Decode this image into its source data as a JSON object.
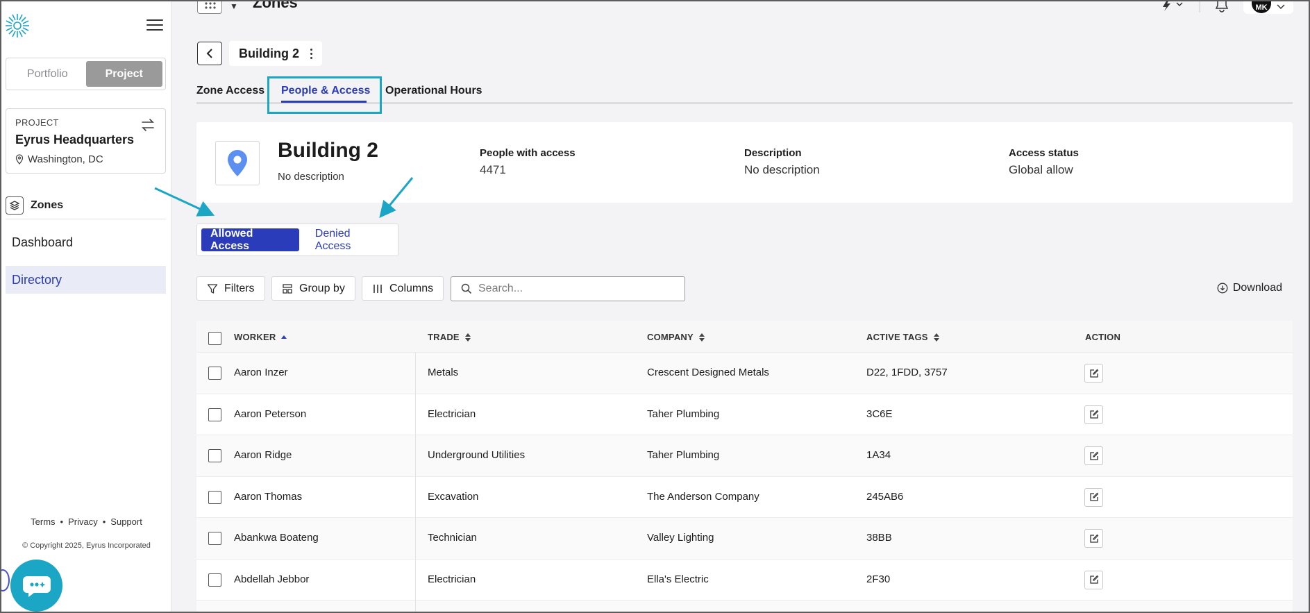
{
  "header": {
    "page_title": "Zones",
    "avatar_initials": "MK"
  },
  "sidebar": {
    "segment": {
      "portfolio": "Portfolio",
      "project": "Project",
      "active": "Project"
    },
    "project_card": {
      "kicker": "PROJECT",
      "name": "Eyrus Headquarters",
      "location": "Washington, DC"
    },
    "zones_label": "Zones",
    "nav": [
      {
        "label": "Dashboard",
        "active": false
      },
      {
        "label": "Directory",
        "active": true
      }
    ],
    "footer": {
      "terms": "Terms",
      "privacy": "Privacy",
      "support": "Support",
      "copyright": "© Copyright 2025, Eyrus Incorporated"
    }
  },
  "breadcrumb": {
    "title": "Building 2"
  },
  "tabs": [
    {
      "label": "Zone Access",
      "active": false
    },
    {
      "label": "People & Access",
      "active": true
    },
    {
      "label": "Operational Hours",
      "active": false
    }
  ],
  "summary": {
    "title": "Building 2",
    "description": "No description",
    "stats": [
      {
        "label": "People with access",
        "value": "4471"
      },
      {
        "label": "Description",
        "value": "No description"
      },
      {
        "label": "Access status",
        "value": "Global allow"
      }
    ]
  },
  "access_toggle": {
    "allowed": "Allowed Access",
    "denied": "Denied Access",
    "active": "allowed"
  },
  "toolbar": {
    "filters": "Filters",
    "group_by": "Group by",
    "columns": "Columns",
    "search_placeholder": "Search...",
    "download": "Download"
  },
  "table": {
    "columns": [
      "WORKER",
      "TRADE",
      "COMPANY",
      "ACTIVE TAGS",
      "ACTION"
    ],
    "sorted_by": "WORKER",
    "rows": [
      {
        "worker": "Aaron Inzer",
        "trade": "Metals",
        "company": "Crescent Designed Metals",
        "tags": "D22, 1FDD, 3757"
      },
      {
        "worker": "Aaron Peterson",
        "trade": "Electrician",
        "company": "Taher Plumbing",
        "tags": "3C6E"
      },
      {
        "worker": "Aaron Ridge",
        "trade": "Underground Utilities",
        "company": "Taher Plumbing",
        "tags": "1A34"
      },
      {
        "worker": "Aaron Thomas",
        "trade": "Excavation",
        "company": "The Anderson Company",
        "tags": "245AB6"
      },
      {
        "worker": "Abankwa Boateng",
        "trade": "Technician",
        "company": "Valley Lighting",
        "tags": "38BB"
      },
      {
        "worker": "Abdellah Jebbor",
        "trade": "Electrician",
        "company": "Ella's Electric",
        "tags": "2F30"
      }
    ]
  },
  "colors": {
    "primary": "#2a3cba",
    "accent": "#1ca6c6",
    "annotation": "#1ca6c6"
  }
}
